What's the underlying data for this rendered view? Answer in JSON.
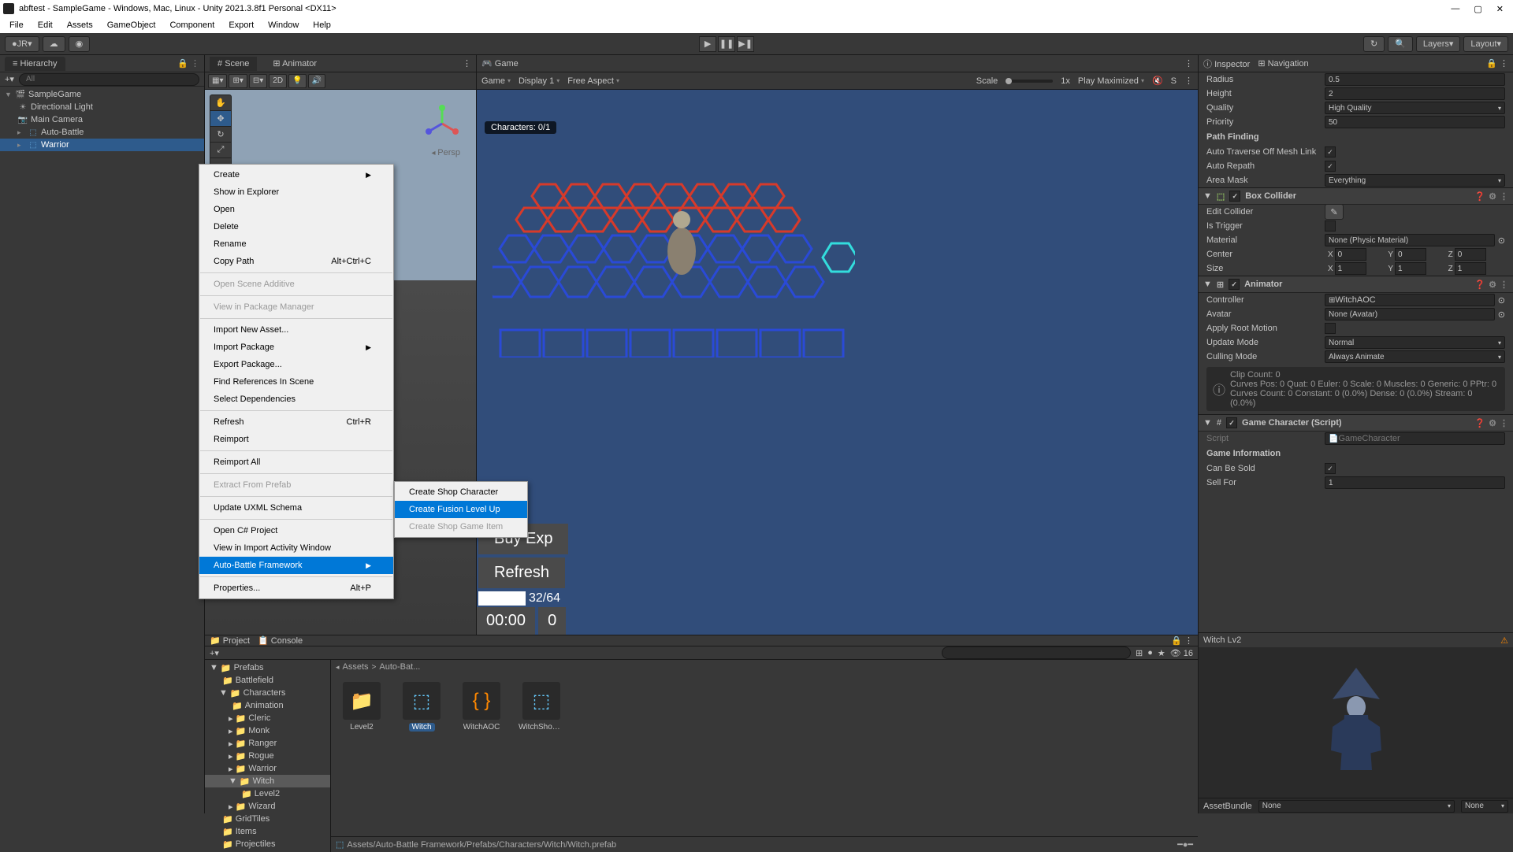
{
  "window": {
    "title": "abftest - SampleGame - Windows, Mac, Linux - Unity 2021.3.8f1 Personal <DX11>"
  },
  "menubar": [
    "File",
    "Edit",
    "Assets",
    "GameObject",
    "Component",
    "Export",
    "Window",
    "Help"
  ],
  "toolbar": {
    "account": "JR",
    "layers": "Layers",
    "layout": "Layout"
  },
  "hierarchy": {
    "tab": "Hierarchy",
    "search_placeholder": "All",
    "root": "SampleGame",
    "items": [
      "Directional Light",
      "Main Camera",
      "Auto-Battle",
      "Warrior"
    ]
  },
  "scene": {
    "tab_scene": "Scene",
    "tab_animator": "Animator",
    "btn_2d": "2D",
    "persp": "Persp"
  },
  "game": {
    "tab": "Game",
    "dd_game": "Game",
    "dd_display": "Display 1",
    "dd_aspect": "Free Aspect",
    "scale_label": "Scale",
    "scale_value": "1x",
    "play_mode": "Play Maximized",
    "stats": "S",
    "characters": "Characters: 0/1",
    "buy_exp": "Buy Exp",
    "refresh": "Refresh",
    "progress": "32/64",
    "time": "00:00",
    "score": "0"
  },
  "project": {
    "tab_project": "Project",
    "tab_console": "Console",
    "tree": {
      "root": "Prefabs",
      "folders": [
        "Battlefield",
        "Characters",
        "Animation",
        "Cleric",
        "Monk",
        "Ranger",
        "Rogue",
        "Warrior",
        "Witch",
        "Level2",
        "Wizard",
        "GridTiles",
        "Items",
        "Projectiles"
      ]
    },
    "breadcrumb": [
      "Assets",
      "Auto-Bat..."
    ],
    "assets": [
      {
        "name": "Level2",
        "type": "folder"
      },
      {
        "name": "Witch",
        "type": "prefab",
        "selected": true
      },
      {
        "name": "WitchAOC",
        "type": "anim"
      },
      {
        "name": "WitchShopI...",
        "type": "prefab"
      }
    ],
    "footer_path": "Assets/Auto-Battle Framework/Prefabs/Characters/Witch/Witch.prefab",
    "eye_count": "16"
  },
  "inspector": {
    "tab_inspector": "Inspector",
    "tab_navigation": "Navigation",
    "navagent": {
      "radius_label": "Radius",
      "radius": "0.5",
      "height_label": "Height",
      "height": "2",
      "quality_label": "Quality",
      "quality": "High Quality",
      "priority_label": "Priority",
      "priority": "50",
      "section_pathfinding": "Path Finding",
      "auto_traverse_label": "Auto Traverse Off Mesh Link",
      "auto_repath_label": "Auto Repath",
      "area_mask_label": "Area Mask",
      "area_mask": "Everything"
    },
    "boxcollider": {
      "title": "Box Collider",
      "edit_label": "Edit Collider",
      "trigger_label": "Is Trigger",
      "material_label": "Material",
      "material": "None (Physic Material)",
      "center_label": "Center",
      "cx": "0",
      "cy": "0",
      "cz": "0",
      "size_label": "Size",
      "sx": "1",
      "sy": "1",
      "sz": "1"
    },
    "animator": {
      "title": "Animator",
      "controller_label": "Controller",
      "controller": "WitchAOC",
      "avatar_label": "Avatar",
      "avatar": "None (Avatar)",
      "rootmotion_label": "Apply Root Motion",
      "update_label": "Update Mode",
      "update": "Normal",
      "culling_label": "Culling Mode",
      "culling": "Always Animate",
      "info1": "Clip Count: 0",
      "info2": "Curves Pos: 0 Quat: 0 Euler: 0 Scale: 0 Muscles: 0 Generic: 0 PPtr: 0",
      "info3": "Curves Count: 0 Constant: 0 (0.0%) Dense: 0 (0.0%) Stream: 0 (0.0%)"
    },
    "gamechar": {
      "title": "Game Character (Script)",
      "script_label": "Script",
      "script": "GameCharacter",
      "section": "Game Information",
      "canbesold_label": "Can Be Sold",
      "sellfor_label": "Sell For",
      "sellfor": "1"
    },
    "preview_title": "Witch Lv2",
    "assetbundle_label": "AssetBundle",
    "assetbundle_value": "None",
    "assetbundle_value2": "None"
  },
  "context_menu": {
    "items": [
      {
        "label": "Create",
        "arrow": true
      },
      {
        "label": "Show in Explorer"
      },
      {
        "label": "Open"
      },
      {
        "label": "Delete"
      },
      {
        "label": "Rename"
      },
      {
        "label": "Copy Path",
        "shortcut": "Alt+Ctrl+C"
      },
      {
        "sep": true
      },
      {
        "label": "Open Scene Additive",
        "disabled": true
      },
      {
        "sep": true
      },
      {
        "label": "View in Package Manager",
        "disabled": true
      },
      {
        "sep": true
      },
      {
        "label": "Import New Asset..."
      },
      {
        "label": "Import Package",
        "arrow": true
      },
      {
        "label": "Export Package..."
      },
      {
        "label": "Find References In Scene"
      },
      {
        "label": "Select Dependencies"
      },
      {
        "sep": true
      },
      {
        "label": "Refresh",
        "shortcut": "Ctrl+R"
      },
      {
        "label": "Reimport"
      },
      {
        "sep": true
      },
      {
        "label": "Reimport All"
      },
      {
        "sep": true
      },
      {
        "label": "Extract From Prefab",
        "disabled": true
      },
      {
        "sep": true
      },
      {
        "label": "Update UXML Schema"
      },
      {
        "sep": true
      },
      {
        "label": "Open C# Project"
      },
      {
        "label": "View in Import Activity Window"
      },
      {
        "label": "Auto-Battle Framework",
        "arrow": true,
        "highlighted": true
      },
      {
        "sep": true
      },
      {
        "label": "Properties...",
        "shortcut": "Alt+P"
      }
    ],
    "submenu": [
      {
        "label": "Create Shop Character"
      },
      {
        "label": "Create Fusion Level Up",
        "highlighted": true
      },
      {
        "label": "Create Shop Game Item",
        "disabled": true
      }
    ]
  }
}
